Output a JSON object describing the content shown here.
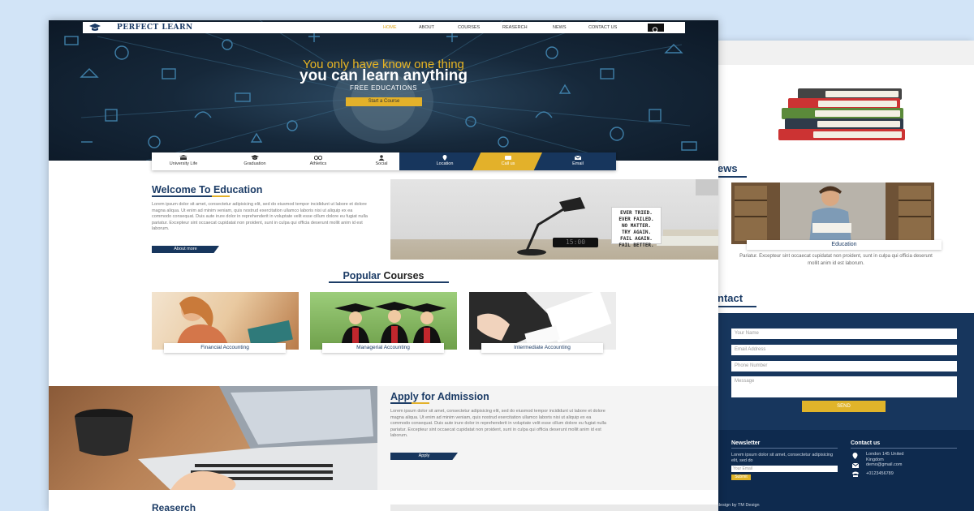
{
  "front": {
    "logo_text": "PERFECT LEARN",
    "nav": [
      "HOME",
      "ABOUT",
      "COURSES",
      "REASERCH",
      "NEWS",
      "CONTACT US"
    ],
    "hero": {
      "line1": "You only have know one thing",
      "line2": "you can learn anything",
      "line3": "FREE EDUCATIONS",
      "cta": "Start a Course"
    },
    "tabs": [
      "University Life",
      "Graduation",
      "Athletics",
      "Social",
      "Location",
      "Call us",
      "Email"
    ],
    "welcome": {
      "title": "Welcome To Education",
      "text": "Lorem ipsum dolor sit amet, consectetur adipisicing elit, sed do eiusmod tempor incididunt ut labore et dolore magna aliqua. Ut enim ad minim veniam, quis nostrud exercitation ullamco laboris nisi ut aliquip ex ea commodo consequat. Duis aute irure dolor in reprehenderit in voluptate velit esse cillum dolore eu fugiat nulla pariatur. Excepteur sint occaecat cupidatat non proident, sunt in culpa qui officia deserunt mollit anim id est laborum.",
      "button": "About more",
      "poster": [
        "EVER TRIED.",
        "EVER FAILED.",
        "NO MATTER.",
        "TRY AGAIN.",
        "FAIL AGAIN.",
        "FAIL BETTER."
      ],
      "clock": "15:00"
    },
    "popular": {
      "title_highlight": "Popular",
      "title_rest": " Courses",
      "courses": [
        "Financial Accounting",
        "Managerial Accounting",
        "Intermediate Accounting"
      ]
    },
    "admission": {
      "title": "Apply for Admission",
      "text": "Lorem ipsum dolor sit amet, consectetur adipisicing elit, sed do eiusmod tempor incididunt ut labore et dolore magna aliqua. Ut enim ad minim veniam, quis nostrud exercitation ullamco laboris nisi ut aliquip ex ea commodo consequat. Duis aute irure dolor in reprehenderit in voluptate velit esse cillum dolore eu fugiat nulla pariatur. Excepteur sint occaecat cupidatat non proident, sunt in culpa qui officia deserunt mollit anim id est laborum.",
      "button": "Apply"
    },
    "research_title": "Reaserch"
  },
  "back": {
    "news_title": "ews",
    "news_caption": "Education",
    "news_text": "Pariatur. Excepteur sint occaecat cupidatat non proident, sunt in culpa qui officia deserunt mollit anim id est laborum.",
    "contact_title": "ntact",
    "form": {
      "name": "Your Name",
      "email": "Email Address",
      "phone": "Phone Number",
      "message": "Message",
      "send": "SEND"
    },
    "footer": {
      "newsletter_title": "Newsletter",
      "newsletter_text": "Lorem ipsum dolor sit amet, consectetur adipisicing elit, sed do",
      "newsletter_placeholder": "Your Email",
      "newsletter_button": "Submit",
      "contact_title": "Contact us",
      "address": "London 145 United Kingdom",
      "email": "demo@gmail.com",
      "phone": "+0123456789",
      "credit": "design by TM Design"
    }
  },
  "colors": {
    "navy": "#17365d",
    "gold": "#e3b12a",
    "background": "#d2e4f7"
  }
}
